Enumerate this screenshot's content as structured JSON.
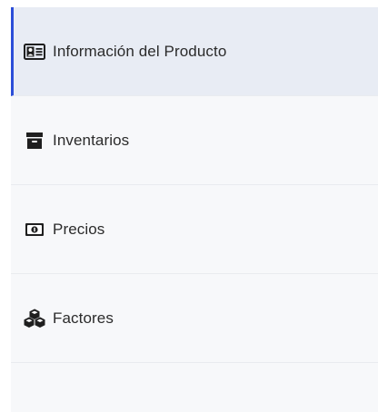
{
  "sidebar": {
    "accent_color": "#2c4ed8",
    "items": [
      {
        "label": "Información del Producto",
        "icon": "id-card-icon",
        "active": true
      },
      {
        "label": "Inventarios",
        "icon": "archive-box-icon",
        "active": false
      },
      {
        "label": "Precios",
        "icon": "money-bill-icon",
        "active": false
      },
      {
        "label": "Factores",
        "icon": "cubes-icon",
        "active": false
      }
    ]
  }
}
